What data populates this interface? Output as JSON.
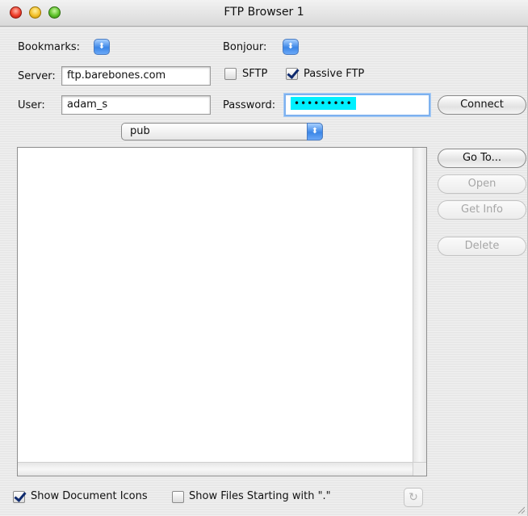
{
  "window": {
    "title": "FTP Browser 1"
  },
  "form": {
    "bookmarks_label": "Bookmarks:",
    "bonjour_label": "Bonjour:",
    "popup_glyph": "⬍",
    "server_label": "Server:",
    "server_value": "ftp.barebones.com",
    "sftp_label": "SFTP",
    "sftp_checked": false,
    "passive_label": "Passive FTP",
    "passive_checked": true,
    "user_label": "User:",
    "user_value": "adam_s",
    "password_label": "Password:",
    "password_value": "•••••••••",
    "connect_label": "Connect"
  },
  "path": {
    "selected": "pub",
    "arrow_glyph": "⬍"
  },
  "actions": {
    "goto_label": "Go To...",
    "open_label": "Open",
    "getinfo_label": "Get Info",
    "delete_label": "Delete"
  },
  "footer": {
    "show_icons_label": "Show Document Icons",
    "show_icons_checked": true,
    "show_dotfiles_label": "Show Files Starting with \".\"",
    "show_dotfiles_checked": false,
    "refresh_glyph": "↻"
  },
  "colors": {
    "accent": "#3b86e6",
    "password_highlight": "#00f0ff"
  }
}
